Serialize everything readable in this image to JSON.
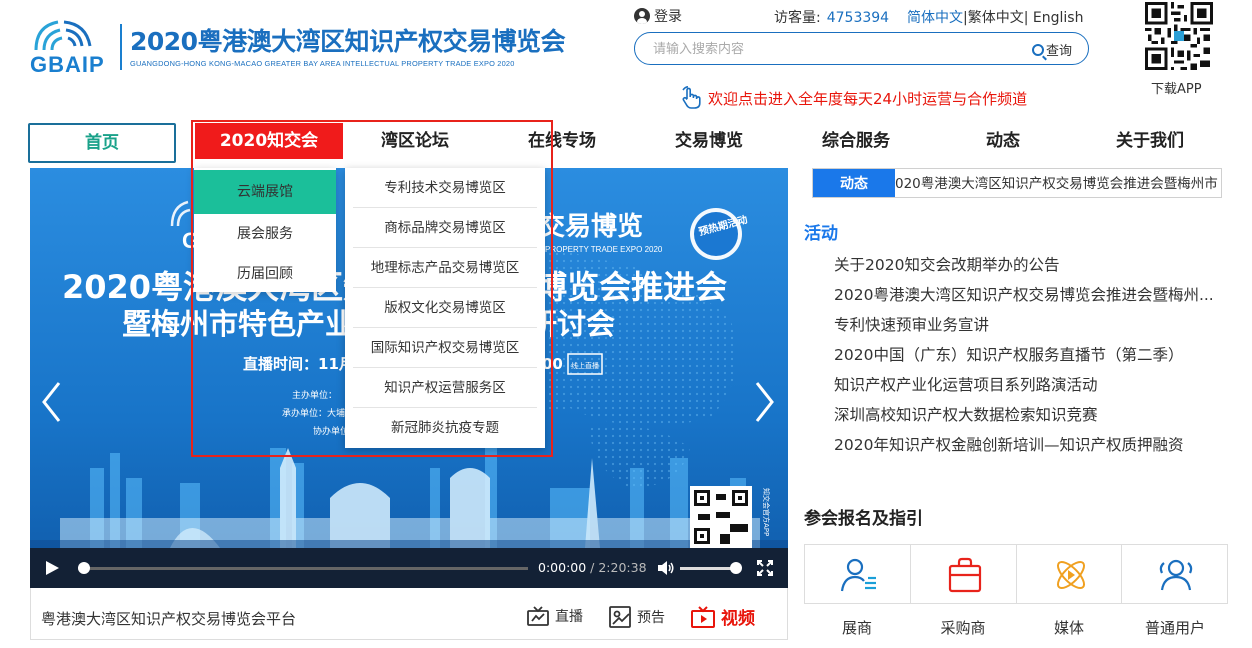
{
  "header": {
    "logo_text": "GBAIP",
    "logo_cn": "2020粤港澳大湾区知识产权交易博览会",
    "logo_en": "GUANGDONG-HONG KONG-MACAO GREATER BAY AREA INTELLECTUAL PROPERTY TRADE EXPO 2020",
    "login": "登录",
    "visits_label": "访客量:",
    "visits_count": "4753394",
    "lang_simplified": "简体中文",
    "lang_sep1": "|",
    "lang_traditional": "繁体中文",
    "lang_sep2": "|",
    "lang_english": "English",
    "search_placeholder": "请输入搜索内容",
    "search_button": "查询",
    "welcome": "欢迎点击进入全年度每天24小时运营与合作频道",
    "download_app": "下载APP"
  },
  "nav": {
    "home": "首页",
    "items": [
      "2020知交会",
      "湾区论坛",
      "在线专场",
      "交易博览",
      "综合服务",
      "动态",
      "关于我们"
    ]
  },
  "dropdown": {
    "left": [
      "云端展馆",
      "展会服务",
      "历届回顾"
    ],
    "right": [
      "专利技术交易博览区",
      "商标品牌交易博览区",
      "地理标志产品交易博览区",
      "版权文化交易博览区",
      "国际知识产权交易博览区",
      "知识产权运营服务区",
      "新冠肺炎抗疫专题"
    ]
  },
  "video": {
    "banner_title_right": "交易博览",
    "banner_sub_right": "PROPERTY TRADE EXPO 2020",
    "badge": "预热期活动",
    "headline1": "2020粤港澳大湾区知识产权交易博览会推进会",
    "headline2": "暨梅州市特色产业知识产权主题研讨会",
    "live_time": "直播时间：11月",
    "live_time_end": "00",
    "online_live": "线上直播",
    "host": "主办单位：",
    "organizer": "承办单位：大埔",
    "co": "协办单位",
    "qr_caption": "知交会官方APP",
    "time_current": "0:00:00",
    "time_sep": " / ",
    "time_total": "2:20:38"
  },
  "video_footer": {
    "title": "粤港澳大湾区知识产权交易博览会平台",
    "live": "直播",
    "preview": "预告",
    "video": "视频"
  },
  "ticker": {
    "label": "动态",
    "text": "020粤港澳大湾区知识产权交易博览会推进会暨梅州市"
  },
  "activity": {
    "heading": "活动",
    "items": [
      "关于2020知交会改期举办的公告",
      "2020粤港澳大湾区知识产权交易博览会推进会暨梅州...",
      "专利快速预审业务宣讲",
      "2020中国（广东）知识产权服务直播节（第二季）",
      "知识产权产业化运营项目系列路演活动",
      "深圳高校知识产权大数据检索知识竞赛",
      "2020年知识产权金融创新培训—知识产权质押融资"
    ]
  },
  "registration": {
    "heading": "参会报名及指引",
    "items": [
      "展商",
      "采购商",
      "媒体",
      "普通用户"
    ]
  },
  "colors": {
    "brand_blue": "#1a6fbf",
    "nav_active": "#f01b1b",
    "submenu_active": "#1bbf9a",
    "highlight": "#e8231b",
    "ticker_blue": "#1a78ea"
  }
}
